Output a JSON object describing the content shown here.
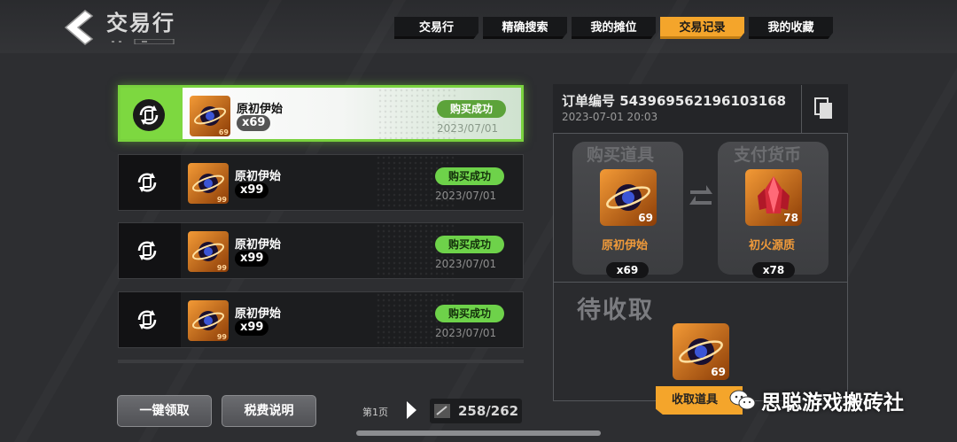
{
  "header": {
    "title": "交易行"
  },
  "tabs": [
    {
      "label": "交易行",
      "active": false
    },
    {
      "label": "精确搜索",
      "active": false
    },
    {
      "label": "我的摊位",
      "active": false
    },
    {
      "label": "交易记录",
      "active": true
    },
    {
      "label": "我的收藏",
      "active": false
    }
  ],
  "records": [
    {
      "item": "原初伊始",
      "icon_badge": "69",
      "qty": "x69",
      "status": "购买成功",
      "date": "2023/07/01",
      "selected": true
    },
    {
      "item": "原初伊始",
      "icon_badge": "99",
      "qty": "x99",
      "status": "购买成功",
      "date": "2023/07/01",
      "selected": false
    },
    {
      "item": "原初伊始",
      "icon_badge": "99",
      "qty": "x99",
      "status": "购买成功",
      "date": "2023/07/01",
      "selected": false
    },
    {
      "item": "原初伊始",
      "icon_badge": "99",
      "qty": "x99",
      "status": "购买成功",
      "date": "2023/07/01",
      "selected": false
    }
  ],
  "footer": {
    "claim_all": "一键领取",
    "tax_info": "税费说明",
    "page_label": "第1页",
    "counter": "258/262"
  },
  "detail": {
    "order_no": "订单编号 543969562196103168",
    "order_time": "2023-07-01 20:03",
    "buy_title": "购买道具",
    "pay_title": "支付货币",
    "buy_item": {
      "name": "原初伊始",
      "badge": "69",
      "qty": "x69"
    },
    "pay_item": {
      "name": "初火源质",
      "badge": "78",
      "qty": "x78"
    },
    "pending_title": "待收取",
    "pending_item": {
      "badge": "69"
    },
    "claim_label": "收取道具"
  },
  "watermark": "思聪游戏搬砖社",
  "colors": {
    "accent": "#f4a52b",
    "success": "#6ed24a",
    "item_orange": "#f09a3a"
  }
}
